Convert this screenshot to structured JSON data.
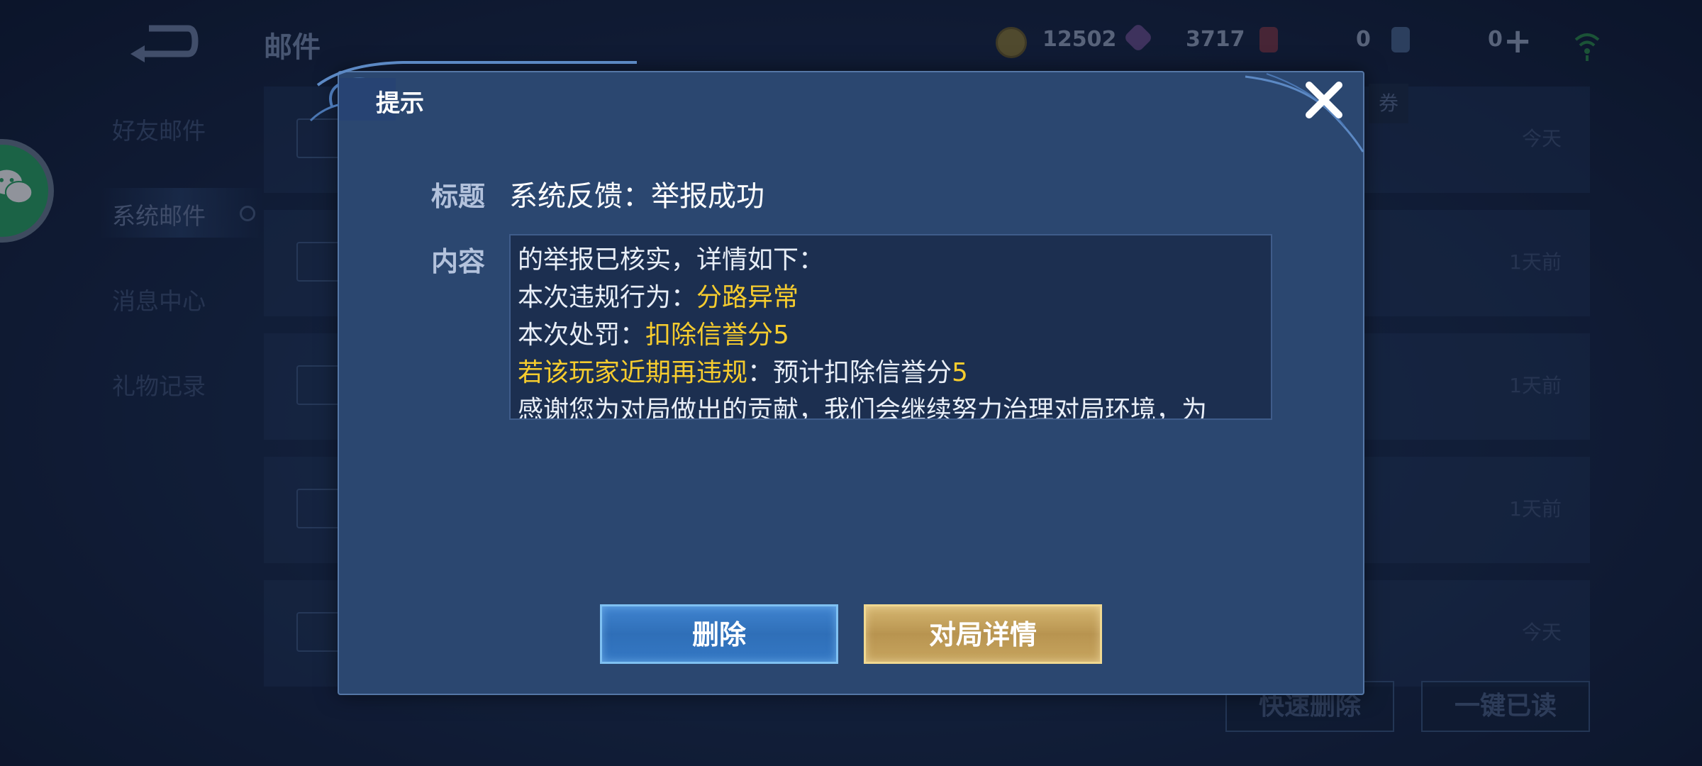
{
  "header": {
    "page_title": "邮件",
    "coins": "12502",
    "gems": "3717",
    "ticket_count": "0",
    "coupon_count": "0"
  },
  "sidebar": {
    "items": [
      {
        "label": "好友邮件"
      },
      {
        "label": "系统邮件"
      },
      {
        "label": "消息中心"
      },
      {
        "label": "礼物记录"
      }
    ]
  },
  "mail_list": {
    "coupon_tag": "券",
    "times": [
      "今天",
      "1天前",
      "1天前",
      "1天前",
      "今天"
    ]
  },
  "footer": {
    "quick_delete": "快速删除",
    "mark_all_read": "一键已读"
  },
  "dialog": {
    "title": "提示",
    "subject_label": "标题",
    "subject_value": "系统反馈：举报成功",
    "content_label": "内容",
    "content": {
      "line1": "的举报已核实，详情如下：",
      "violation_label": "本次违规行为：",
      "violation_value": "分路异常",
      "penalty_label": "本次处罚：",
      "penalty_value": "扣除信誉分5",
      "warning_text": "若该玩家近期再违规",
      "expected_label": "：预计扣除信誉分",
      "expected_value": "5",
      "line5": "感谢您为对局做出的贡献，我们会继续努力治理对局环境，为"
    },
    "delete_label": "删除",
    "detail_label": "对局详情"
  },
  "colors": {
    "highlight": "#f6cc2e",
    "dialog_bg": "#2b4770",
    "delete_button": "#3478c4",
    "detail_button": "#c7a55f"
  }
}
